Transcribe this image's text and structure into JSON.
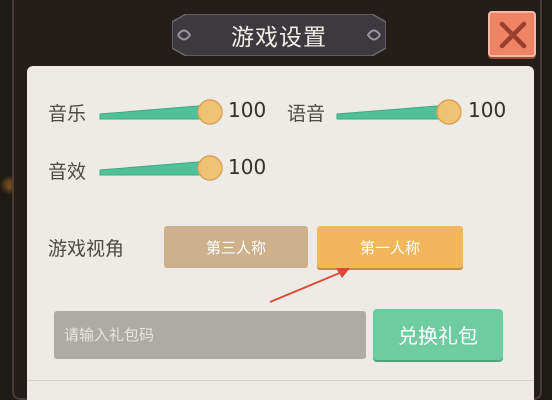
{
  "dialog": {
    "title": "游戏设置",
    "close_icon": "close-x-icon"
  },
  "settings": {
    "music": {
      "label": "音乐",
      "value": "100",
      "level": 1.0
    },
    "voice": {
      "label": "语音",
      "value": "100",
      "level": 1.0
    },
    "sfx": {
      "label": "音效",
      "value": "100",
      "level": 1.0
    }
  },
  "view": {
    "label": "游戏视角",
    "third_person": "第三人称",
    "first_person": "第一人称",
    "selected": "第一人称"
  },
  "gift": {
    "placeholder": "请输入礼包码",
    "value": "",
    "redeem_label": "兑换礼包"
  },
  "colors": {
    "slider_fill": "#4fc29a",
    "slider_knob": "#f0c274",
    "first_person_button": "#f2b65d",
    "third_person_button": "#cdb08c",
    "redeem_button": "#6fcca0",
    "close_button": "#ee8466",
    "annotation_arrow": "#e0473a"
  }
}
